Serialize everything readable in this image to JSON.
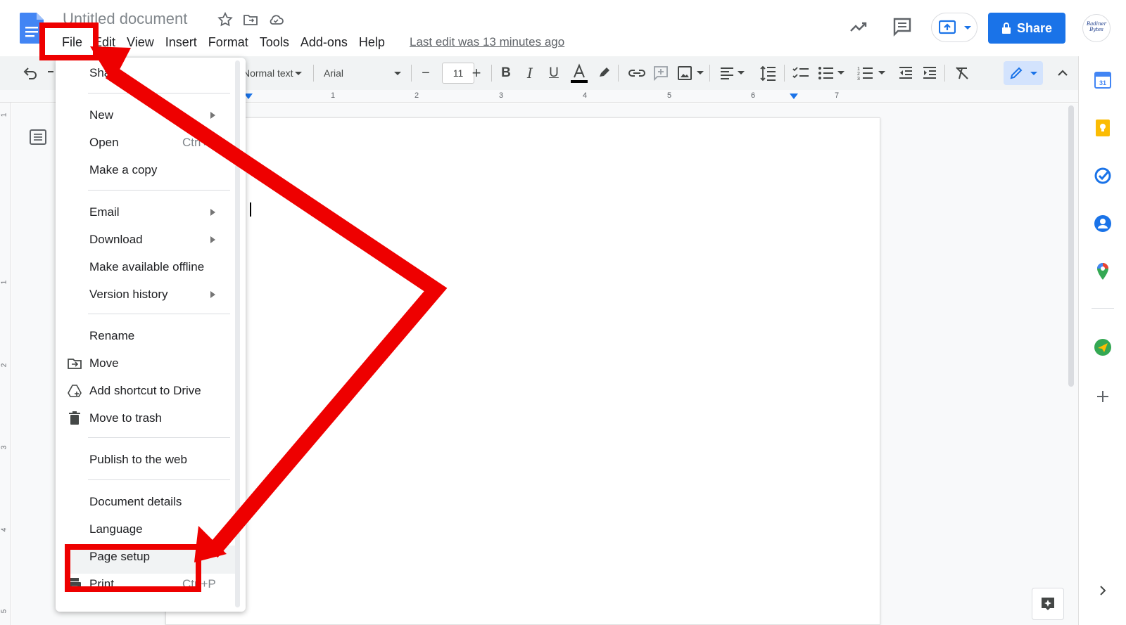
{
  "app": {
    "doc_title": "Untitled document",
    "menus": [
      "File",
      "Edit",
      "View",
      "Insert",
      "Format",
      "Tools",
      "Add-ons",
      "Help"
    ],
    "last_edit": "Last edit was 13 minutes ago",
    "share_label": "Share",
    "avatar_text": "Badiner Bytes"
  },
  "toolbar": {
    "style": "Normal text",
    "font": "Arial",
    "font_size": "11",
    "minus": "−",
    "plus": "+"
  },
  "ruler": {
    "h_numbers": [
      "1",
      "2",
      "3",
      "4",
      "5",
      "6",
      "7"
    ],
    "v_numbers": [
      "1",
      "1",
      "2",
      "3",
      "4",
      "5"
    ]
  },
  "file_menu": {
    "items": [
      {
        "label": "Share"
      },
      {
        "label": "New",
        "submenu": true
      },
      {
        "label": "Open",
        "shortcut": "Ctrl+O"
      },
      {
        "label": "Make a copy"
      },
      {
        "label": "Email",
        "submenu": true
      },
      {
        "label": "Download",
        "submenu": true
      },
      {
        "label": "Make available offline"
      },
      {
        "label": "Version history",
        "submenu": true
      },
      {
        "label": "Rename"
      },
      {
        "label": "Move",
        "icon": "move-icon"
      },
      {
        "label": "Add shortcut to Drive",
        "icon": "add-shortcut-icon"
      },
      {
        "label": "Move to trash",
        "icon": "trash-icon"
      },
      {
        "label": "Publish to the web"
      },
      {
        "label": "Document details"
      },
      {
        "label": "Language"
      },
      {
        "label": "Page setup",
        "highlighted": true
      },
      {
        "label": "Print",
        "shortcut": "Ctrl+P",
        "icon": "print-icon"
      }
    ]
  },
  "colors": {
    "accent": "#1a73e8",
    "annotation": "#ee0000",
    "menu_text": "#202124"
  }
}
